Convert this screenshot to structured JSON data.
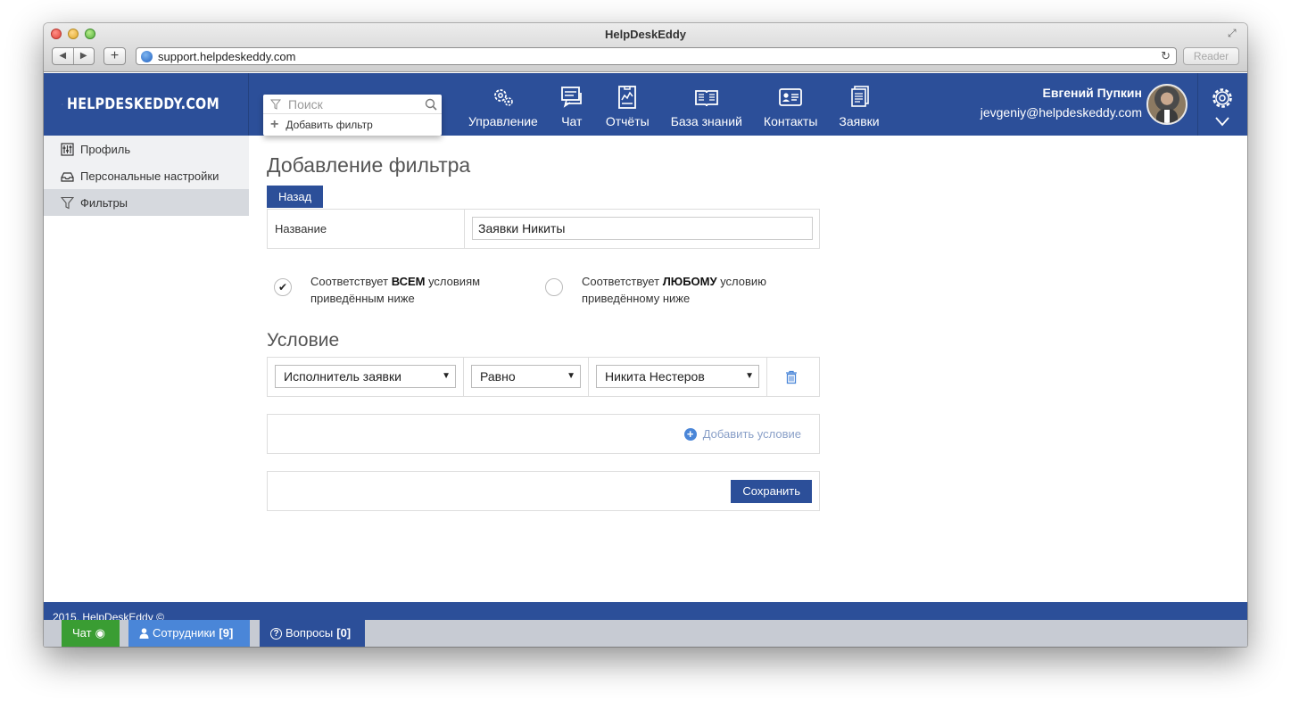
{
  "browser": {
    "title": "HelpDeskEddy",
    "url": "support.helpdeskeddy.com",
    "reader_label": "Reader",
    "back_glyph": "◀",
    "forward_glyph": "▶",
    "plus_glyph": "+",
    "reload_glyph": "↻",
    "fullscreen_glyph": "⤢"
  },
  "header": {
    "logo_text": "HELPDESKEDDY.COM",
    "search": {
      "placeholder": "Поиск",
      "add_filter_label": "Добавить фильтр"
    },
    "nav": [
      {
        "label": "Управление",
        "icon": "gears-icon"
      },
      {
        "label": "Чат",
        "icon": "chat-icon"
      },
      {
        "label": "Отчёты",
        "icon": "report-icon"
      },
      {
        "label": "База знаний",
        "icon": "book-icon"
      },
      {
        "label": "Контакты",
        "icon": "contacts-icon"
      },
      {
        "label": "Заявки",
        "icon": "tickets-icon"
      }
    ],
    "user": {
      "name": "Евгений Пупкин",
      "email": "jevgeniy@helpdeskeddy.com"
    }
  },
  "sidebar": {
    "items": [
      {
        "label": "Профиль",
        "icon": "profile-icon",
        "active": false
      },
      {
        "label": "Персональные настройки",
        "icon": "settings-tray-icon",
        "active": false
      },
      {
        "label": "Фильтры",
        "icon": "filter-icon",
        "active": true
      }
    ]
  },
  "main": {
    "title": "Добавление фильтра",
    "back_label": "Назад",
    "name_label": "Название",
    "name_value": "Заявки Никиты",
    "match_all": {
      "prefix": "Соответствует ",
      "bold": "ВСЕМ",
      "suffix": " условиям",
      "line2": "приведённым ниже",
      "checked": true,
      "check_glyph": "✔"
    },
    "match_any": {
      "prefix": "Соответствует ",
      "bold": "ЛЮБОМУ",
      "suffix": " условию",
      "line2": "приведённому ниже",
      "checked": false
    },
    "condition_title": "Условие",
    "condition": {
      "field": "Исполнитель заявки",
      "operator": "Равно",
      "value": "Никита Нестеров",
      "arrow_glyph": "▼"
    },
    "add_condition_label": "Добавить условие",
    "add_condition_glyph": "+",
    "save_label": "Сохранить"
  },
  "footer": {
    "copyright": "2015, HelpDeskEddy ©"
  },
  "bottom_bar": {
    "chat": {
      "label": "Чат",
      "glyph": "◉"
    },
    "staff": {
      "label": "Сотрудники",
      "count": "[9]"
    },
    "questions": {
      "label": "Вопросы",
      "count": "[0]",
      "glyph": "?"
    }
  },
  "colors": {
    "header_bg": "#2c4f99",
    "chat_tab": "#3a9d33",
    "staff_tab": "#4a86d8",
    "sidebar_active": "#d6d9de"
  }
}
